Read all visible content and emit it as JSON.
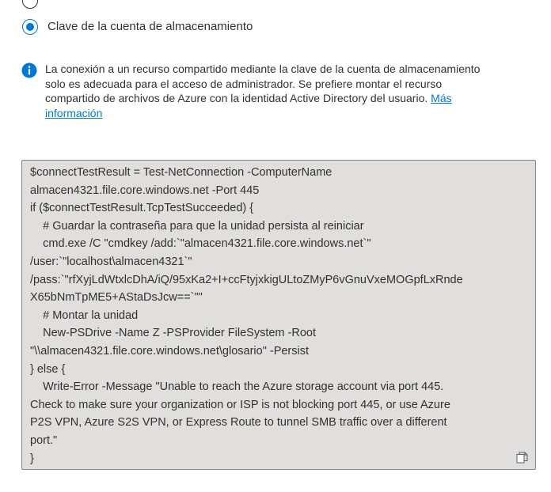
{
  "auth_option": {
    "selected_label": "Clave de la cuenta de almacenamiento"
  },
  "info": {
    "icon": "info-icon",
    "text": "La conexión a un recurso compartido mediante la clave de la cuenta de almacenamiento solo es adecuada para el acceso de administrador. Se prefiere montar el recurso compartido de archivos de Azure con la identidad Active Directory del usuario. ",
    "link_label": "Más información"
  },
  "script": {
    "lines": [
      "$connectTestResult = Test-NetConnection -ComputerName",
      "almacen4321.file.core.windows.net -Port 445",
      "if ($connectTestResult.TcpTestSucceeded) {",
      "    # Guardar la contraseña para que la unidad persista al reiniciar",
      "    cmd.exe /C \"cmdkey /add:`\"almacen4321.file.core.windows.net`\"",
      "/user:`\"localhost\\almacen4321`\"",
      "/pass:`\"rfXyjLdWtxlcDhA/iQ/95xKa2+I+ccFtyjxkigULtoZMyP6vGnuVxeMOGpfLxRnde",
      "X65bNmTpME5+AStaDsJcw==`\"\"",
      "    # Montar la unidad",
      "    New-PSDrive -Name Z -PSProvider FileSystem -Root",
      "\"\\\\almacen4321.file.core.windows.net\\glosario\" -Persist",
      "} else {",
      "    Write-Error -Message \"Unable to reach the Azure storage account via port 445.",
      "Check to make sure your organization or ISP is not blocking port 445, or use Azure",
      "P2S VPN, Azure S2S VPN, or Express Route to tunnel SMB traffic over a different",
      "port.\"",
      "}"
    ],
    "copy_icon": "copy-icon"
  },
  "colors": {
    "accent": "#0078d4",
    "code_background": "#e1dfdd",
    "text": "#323130"
  }
}
